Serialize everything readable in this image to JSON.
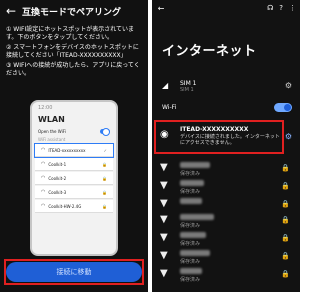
{
  "left": {
    "back_icon": "←",
    "title": "互換モードでペアリング",
    "steps": [
      "① WIFI設定にホットスポットが表示されています。下のボタンをタップしてください。",
      "② スマートフォンをデバイスのホットスポットに接続してください「ITEAD-XXXXXXXXXX」",
      "③ WIFIへの接続が成功したら、アプリに戻ってください。"
    ],
    "phone": {
      "status": "12:00",
      "title": "WLAN",
      "toggle_label": "Open the WiFi",
      "sub_label": "WiFi assistant",
      "items": [
        {
          "name": "ITEAD-xxxxxxxxxx",
          "lock": "✓"
        },
        {
          "name": "Coolkit-1",
          "lock": "🔒"
        },
        {
          "name": "Coolkit-2",
          "lock": "🔒"
        },
        {
          "name": "Coolkit-3",
          "lock": "🔒"
        },
        {
          "name": "Coolkit-HW-2.4G",
          "lock": "🔒"
        }
      ]
    },
    "connect_button": "接続に移動"
  },
  "right": {
    "back_icon": "←",
    "top_icons": [
      "headset-icon",
      "help-icon",
      "more-icon"
    ],
    "title": "インターネット",
    "sim": {
      "name": "SIM 1",
      "status": "SIM 1"
    },
    "wifi_label": "Wi-Fi",
    "wifi_on": true,
    "current": {
      "ssid": "ITEAD-XXXXXXXXXX",
      "status": "デバイスに接続されました。インターネットにアクセスできません。"
    },
    "networks": [
      {
        "status": "保存済み"
      },
      {
        "status": "保存済み"
      },
      {
        "status": ""
      },
      {
        "status": "保存済み"
      },
      {
        "status": "保存済み"
      },
      {
        "status": "保存済み"
      },
      {
        "status": "保存済み"
      }
    ],
    "colors": {
      "accent": "#1f5fd6",
      "highlight": "#e02020"
    }
  }
}
